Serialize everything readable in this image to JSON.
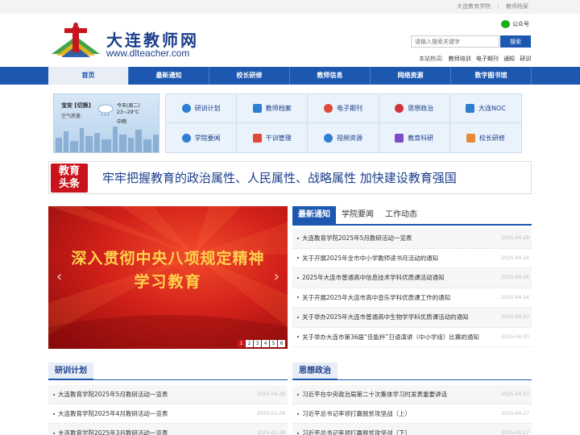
{
  "topbar": {
    "links": [
      "大连教育学院",
      "教师档案"
    ],
    "separator": "|"
  },
  "header": {
    "logo_text": "大连教师网",
    "logo_url": "www.dlteacher.com",
    "wechat_label": "公众号",
    "search": {
      "placeholder": "请输入搜索关键字",
      "button": "搜索"
    },
    "hotwords_label": "本站热词:",
    "hotwords": [
      "教师培训",
      "电子期刊",
      "通知",
      "研训"
    ]
  },
  "nav": [
    "首页",
    "最新通知",
    "校长研修",
    "教师信息",
    "网络资源",
    "数字图书馆"
  ],
  "weather": {
    "city": "宝安 [切换]",
    "air_quality": "空气质量:",
    "day": "今天(周二)",
    "temperature": "23~29°C",
    "condition": "中雨"
  },
  "quick_links": [
    {
      "label": "研训计划",
      "icon": "target-icon",
      "color": "#2f7fd0"
    },
    {
      "label": "教师档案",
      "icon": "folder-icon",
      "color": "#2f7fd0"
    },
    {
      "label": "电子期刊",
      "icon": "journal-icon",
      "color": "#e04a3a"
    },
    {
      "label": "思想政治",
      "icon": "medal-icon",
      "color": "#d0343a"
    },
    {
      "label": "大连NOC",
      "icon": "book-icon",
      "color": "#2f7fd0"
    },
    {
      "label": "学院要闻",
      "icon": "home-icon",
      "color": "#2f7fd0"
    },
    {
      "label": "干训管理",
      "icon": "video-icon",
      "color": "#e04a3a"
    },
    {
      "label": "视频资源",
      "icon": "user-icon",
      "color": "#2f7fd0"
    },
    {
      "label": "教育科研",
      "icon": "research-icon",
      "color": "#7d4bc8"
    },
    {
      "label": "校长研修",
      "icon": "principal-icon",
      "color": "#e8893a"
    }
  ],
  "headline": {
    "badge_line1": "教育",
    "badge_line2": "头条",
    "text": "牢牢把握教育的政治属性、人民属性、战略属性 加快建设教育强国"
  },
  "banner": {
    "line1": "深入贯彻中央八项规定精神",
    "line2": "学习教育",
    "prev": "‹",
    "next": "›",
    "pages": [
      "1",
      "2",
      "3",
      "4",
      "5",
      "6"
    ],
    "active_page": 1
  },
  "news": {
    "tabs": [
      "最新通知",
      "学院要闻",
      "工作动态"
    ],
    "items": [
      {
        "title": "大连教育学院2025年5月教研活动一览表",
        "date": "2025-04-29"
      },
      {
        "title": "关于开展2025年全市中小学教师读书月活动的通知",
        "date": "2025-04-24"
      },
      {
        "title": "2025年大连市普通高中信息技术学科优质课活动通知",
        "date": "2025-04-16"
      },
      {
        "title": "关于开展2025年大连市高中音乐学科优质课工作的通知",
        "date": "2025-04-14"
      },
      {
        "title": "关于举办2025年大连市普通高中生物学学科优质课活动的通知",
        "date": "2025-04-07"
      },
      {
        "title": "关于举办大连市第36届“佳能杯”日语演讲（中小学组）比赛的通知",
        "date": "2025-04-03"
      }
    ]
  },
  "training_plan": {
    "title": "研训计划",
    "items": [
      {
        "title": "大连教育学院2025年5月教研活动一览表",
        "date": "2025-04-29"
      },
      {
        "title": "大连教育学院2025年4月教研活动一览表",
        "date": "2025-03-28"
      },
      {
        "title": "大连教育学院2025年3月教研活动一览表",
        "date": "2025-02-28"
      }
    ]
  },
  "ideology": {
    "title": "思想政治",
    "items": [
      {
        "title": "习近平在中央政治局第二十次集体学习时发表重要讲话",
        "date": "2025-04-27"
      },
      {
        "title": "习近平总书记率领打赢脱贫攻坚战（上）",
        "date": "2025-04-27"
      },
      {
        "title": "习近平总书记率领打赢脱贫攻坚战（下）",
        "date": "2025-04-27"
      }
    ]
  }
}
